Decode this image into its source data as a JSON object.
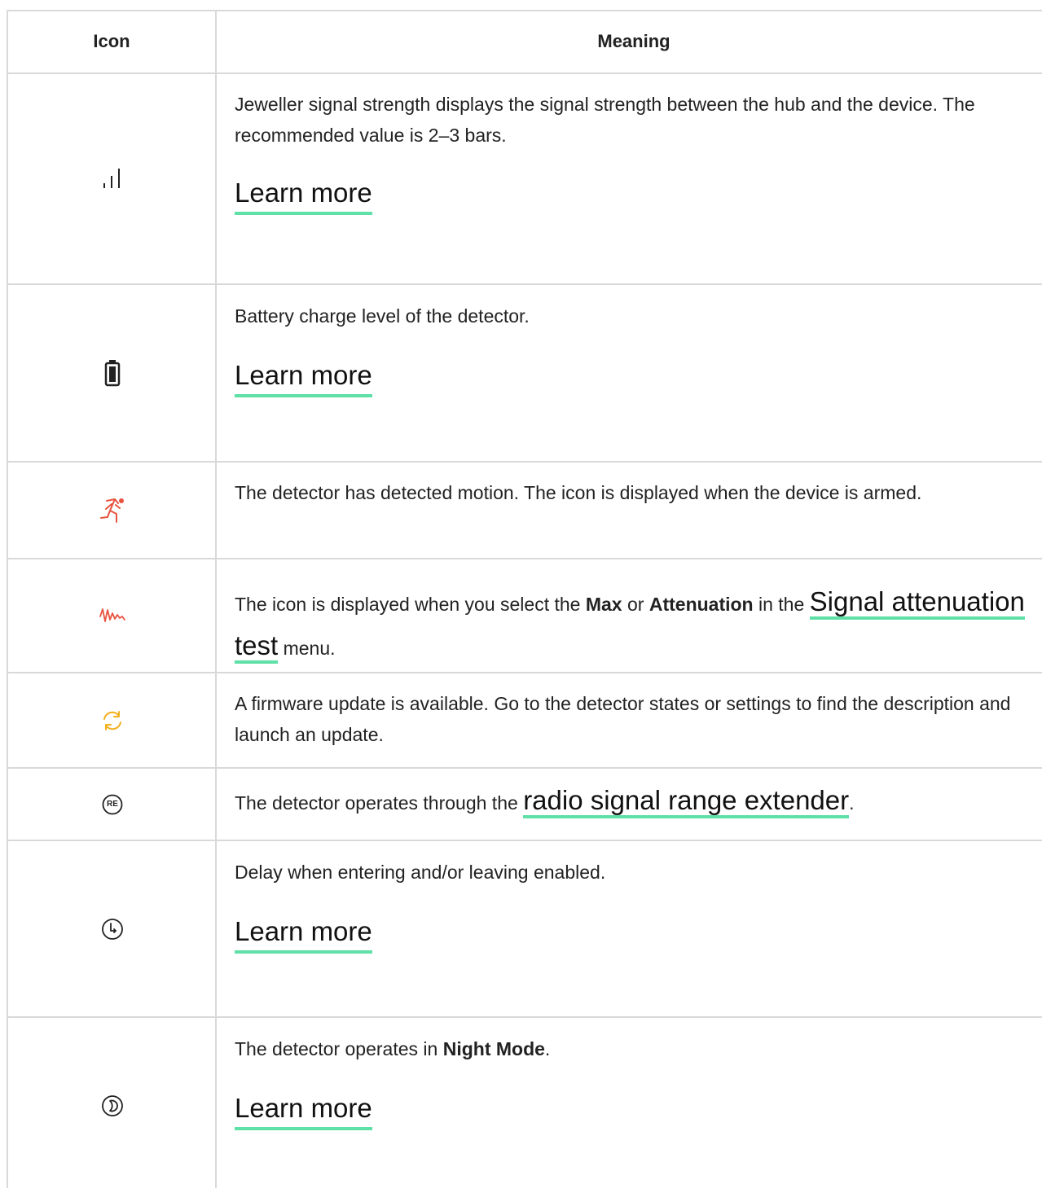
{
  "header": {
    "icon_col": "Icon",
    "meaning_col": "Meaning"
  },
  "rows": [
    {
      "icon": "signal-strength-icon",
      "text": "Jeweller signal strength displays the signal strength between the hub and the device. The recommended value is 2–3 bars.",
      "link": "Learn more"
    },
    {
      "icon": "battery-icon",
      "text": "Battery charge level of the detector.",
      "link": "Learn more"
    },
    {
      "icon": "motion-detected-icon",
      "text": "The detector has detected motion. The icon is displayed when the device is armed."
    },
    {
      "icon": "signal-attenuation-icon",
      "text_pre": "The icon is displayed when you select the ",
      "bold1": "Max",
      "text_mid1": " or ",
      "bold2": "Attenuation",
      "text_mid2": " in the ",
      "link": "Signal attenuation test",
      "text_post": " menu."
    },
    {
      "icon": "firmware-update-icon",
      "text": "A firmware update is available. Go to the detector states or settings to find the description and launch an update."
    },
    {
      "icon": "range-extender-icon",
      "icon_label": "RE",
      "text_pre": "The detector operates through the ",
      "link": "radio signal range extender",
      "text_post": "."
    },
    {
      "icon": "delay-clock-icon",
      "text": "Delay when entering and/or leaving enabled.",
      "link": "Learn more"
    },
    {
      "icon": "night-mode-icon",
      "text_pre": "The detector operates in ",
      "bold1": "Night Mode",
      "text_post": ".",
      "link": "Learn more"
    }
  ],
  "colors": {
    "divider": "#d9d9d9",
    "link_underline": "#5fe0a7",
    "motion": "#e8533f",
    "attenuation": "#e8533f",
    "update": "#f2b01e"
  }
}
